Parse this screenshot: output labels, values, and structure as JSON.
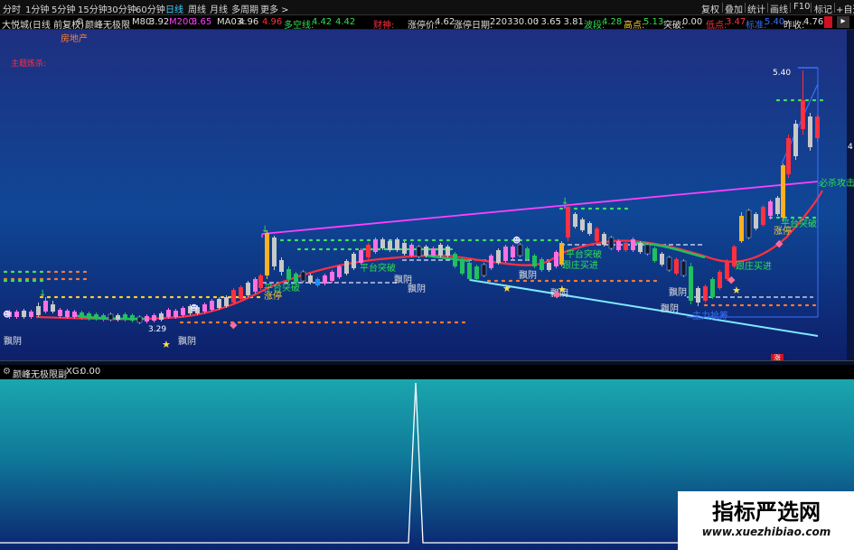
{
  "toolbar": {
    "left_tabs": [
      "分时",
      "1分钟",
      "5分钟",
      "15分钟",
      "30分钟",
      "60分钟",
      "日线",
      "周线",
      "月线",
      "多周期",
      "更多 >"
    ],
    "active_tab": "日线",
    "right_tabs": [
      "复权",
      "叠加",
      "统计",
      "画线",
      "F10",
      "标记",
      "+自选"
    ]
  },
  "infobar": {
    "title": "大悦城(日线 前复权)",
    "indicator": "颜峰无极限",
    "m80_label": "M80:",
    "m80": "3.92",
    "m200_label": "M200:",
    "m200": "3.65",
    "ma03_label": "MA03:",
    "ma03_a": "4.96",
    "ma03_b": "4.96",
    "duokong_label": "多空线:",
    "duokong_a": "4.42",
    "duokong_b": "4.42",
    "caishen": "财神:",
    "zhangting_label": "涨停价:",
    "zhangting": "4.62",
    "zhangting_date_label": "涨停日期:",
    "zhangting_date": "220330.00",
    "v1": ": 3.65",
    "v2": ": 3.81",
    "boduan_label": "波段:",
    "boduan": "4.28",
    "gaodian_label": "高点:",
    "gaodian": "5.13",
    "tupo_label": "突破:",
    "tupo": "0.00",
    "didian_label": "低点:",
    "didian": "3.47",
    "biaozhun_label": "标准:",
    "biaozhun": "5.40",
    "zuoshou_label": "昨收:",
    "zuoshou": "4.76"
  },
  "chart": {
    "sector_tag": "房地产",
    "main_force_label": "主题炼杀:",
    "price_high_label": "5.40",
    "price_low_label": "3.29",
    "axis_marker": "4",
    "annotations": {
      "pingtai1": "平台突破",
      "pingtai2": "平台突破",
      "pingtai3": "平台突破",
      "pingtai4": "平台突破",
      "gengzhuang1": "跟庄买进",
      "gengzhuang2": "跟庄买进",
      "zhangting1": "涨停",
      "zhangting2": "涨停",
      "bibao": "必杀攻击",
      "dui1": "飘阴",
      "dui2": "飘阴",
      "dui3": "飘阴",
      "dui4": "飘阴",
      "dui5": "飘阴",
      "dui6": "飘阴",
      "dui7": "飘阴",
      "dui8": "飘阴",
      "zhuli": "主力抢筹",
      "zhang_bottom": "涨"
    }
  },
  "subchart": {
    "indicator": "颜峰无极限副",
    "xg_label": "XG:",
    "xg_value": "0.00"
  },
  "watermark": {
    "title": "指标严选网",
    "url": "www.xuezhibiao.com"
  },
  "colors": {
    "bg_top": "#1a2a6e",
    "bg_bottom": "#0a3a7a",
    "sub_bg_top": "#1aa0a8",
    "sub_bg_bottom": "#0a2a6e",
    "up_red": "#ff3040",
    "down_green": "#20c060",
    "magenta": "#ff40ff",
    "accent_blue": "#38d0ff"
  }
}
